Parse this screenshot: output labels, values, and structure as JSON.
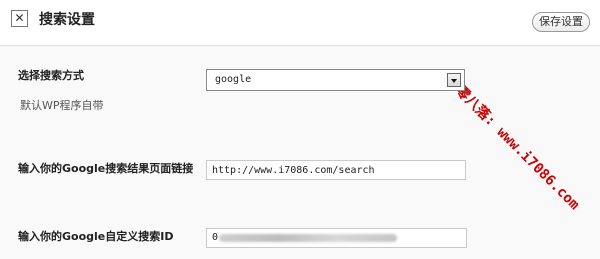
{
  "header": {
    "close_glyph": "✕",
    "title": "搜索设置",
    "save_label": "保存设置"
  },
  "watermark": "七零八落: www.i7086.com",
  "search_method": {
    "label": "选择搜索方式",
    "selected": "google",
    "description": "默认WP程序自带"
  },
  "results_url": {
    "label": "输入你的Google搜索结果页面链接",
    "value": "http://www.i7086.com/search"
  },
  "custom_search_id": {
    "label": "输入你的Google自定义搜索ID",
    "visible_prefix": "0"
  }
}
